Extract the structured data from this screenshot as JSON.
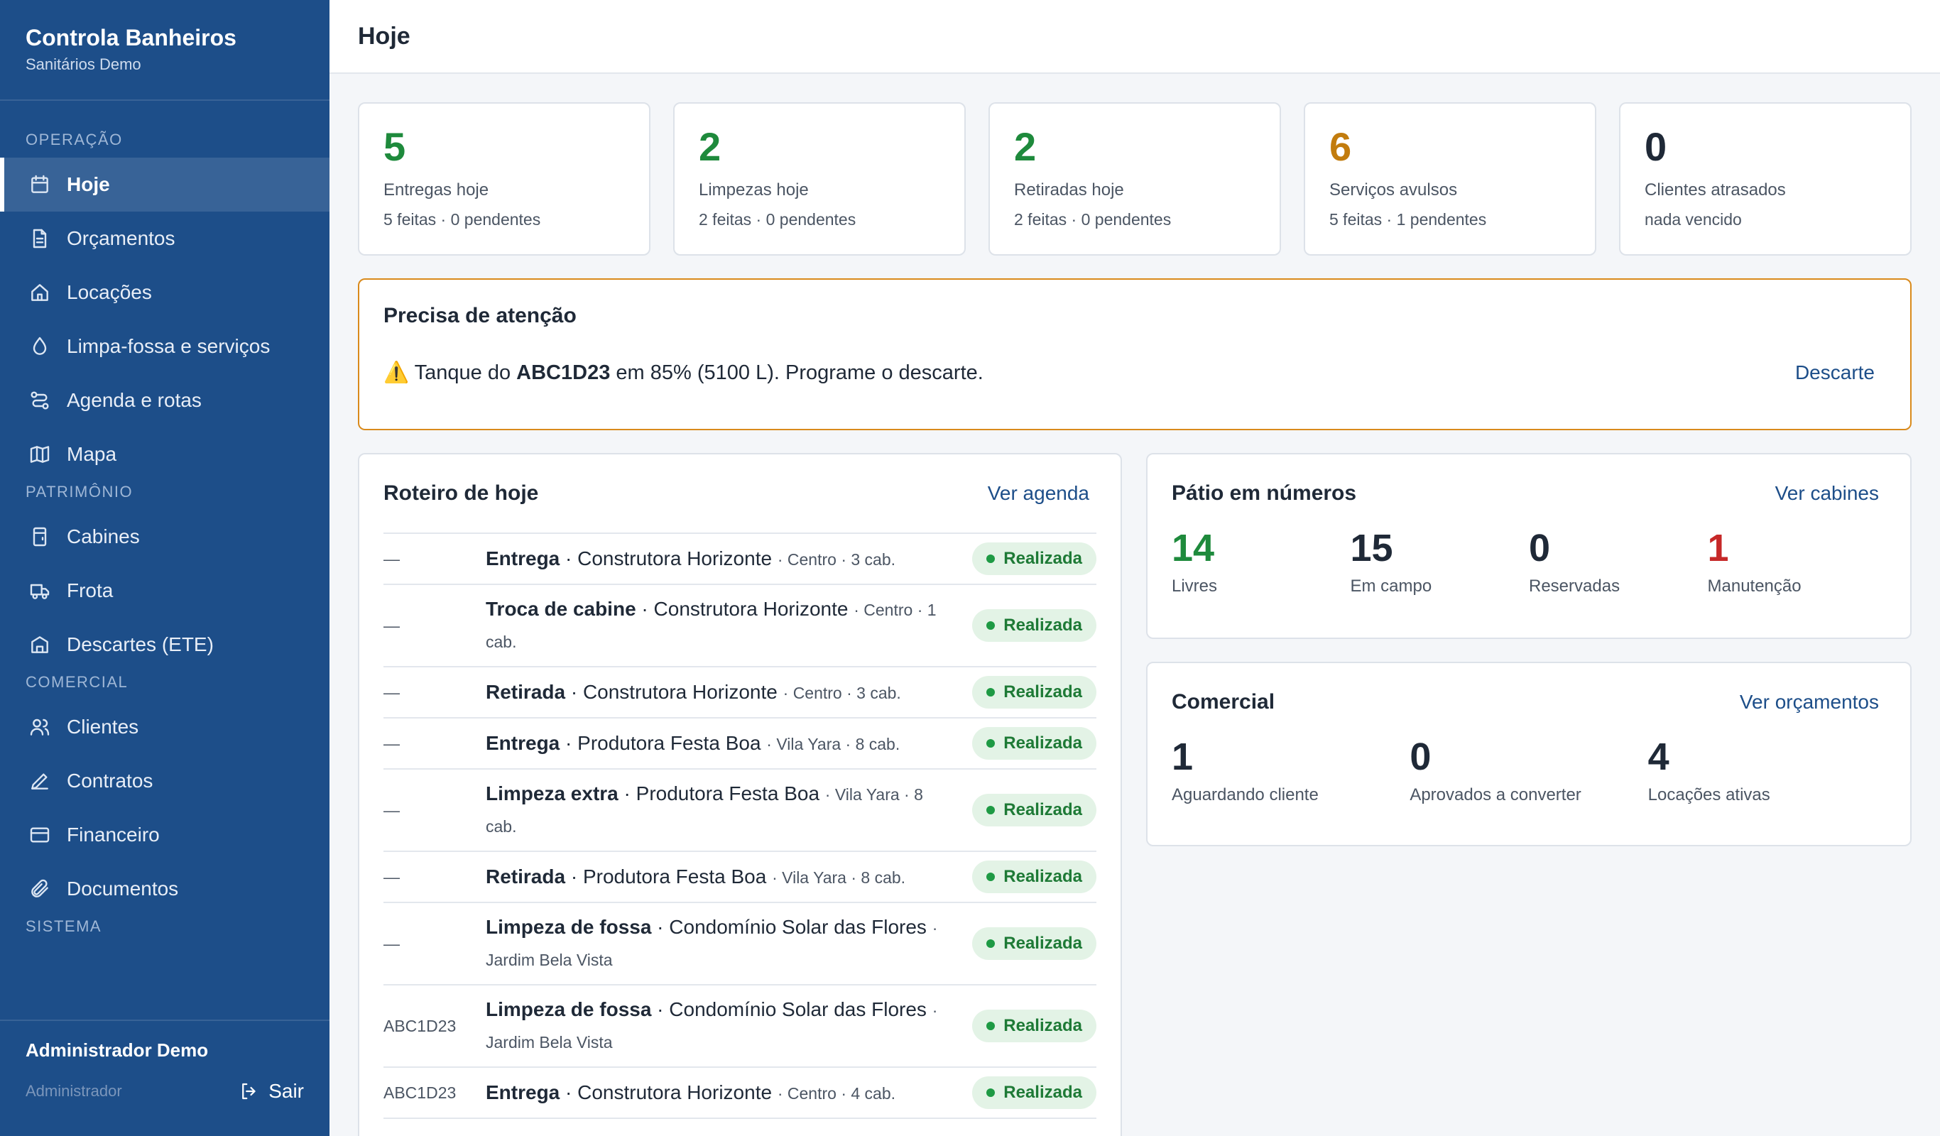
{
  "sidebar": {
    "title": "Controla Banheiros",
    "subtitle": "Sanitários Demo",
    "sections": [
      {
        "label": "OPERAÇÃO",
        "items": [
          {
            "label": "Hoje",
            "icon": "calendar-icon",
            "active": true
          },
          {
            "label": "Orçamentos",
            "icon": "document-icon"
          },
          {
            "label": "Locações",
            "icon": "home-icon"
          },
          {
            "label": "Limpa-fossa e serviços",
            "icon": "droplet-icon"
          },
          {
            "label": "Agenda e rotas",
            "icon": "route-icon"
          },
          {
            "label": "Mapa",
            "icon": "map-icon"
          }
        ]
      },
      {
        "label": "PATRIMÔNIO",
        "items": [
          {
            "label": "Cabines",
            "icon": "cabin-icon"
          },
          {
            "label": "Frota",
            "icon": "truck-icon"
          },
          {
            "label": "Descartes (ETE)",
            "icon": "building-icon"
          }
        ]
      },
      {
        "label": "COMERCIAL",
        "items": [
          {
            "label": "Clientes",
            "icon": "users-icon"
          },
          {
            "label": "Contratos",
            "icon": "pen-icon"
          },
          {
            "label": "Financeiro",
            "icon": "credit-card-icon"
          },
          {
            "label": "Documentos",
            "icon": "paperclip-icon"
          }
        ]
      },
      {
        "label": "SISTEMA",
        "items": []
      }
    ],
    "user": {
      "name": "Administrador Demo",
      "role": "Administrador",
      "logout_label": "Sair"
    }
  },
  "header": {
    "title": "Hoje"
  },
  "stats": [
    {
      "value": "5",
      "label": "Entregas hoje",
      "sub": "5 feitas · 0 pendentes",
      "color": "#1e8a3c"
    },
    {
      "value": "2",
      "label": "Limpezas hoje",
      "sub": "2 feitas · 0 pendentes",
      "color": "#1e8a3c"
    },
    {
      "value": "2",
      "label": "Retiradas hoje",
      "sub": "2 feitas · 0 pendentes",
      "color": "#1e8a3c"
    },
    {
      "value": "6",
      "label": "Serviços avulsos",
      "sub": "5 feitas · 1 pendentes",
      "color": "#c27c0e"
    },
    {
      "value": "0",
      "label": "Clientes atrasados",
      "sub": "nada vencido",
      "color": "#1f2937"
    }
  ],
  "attention": {
    "title": "Precisa de atenção",
    "icon": "⚠️",
    "text_before": "Tanque do ",
    "plate": "ABC1D23",
    "text_after": " em 85% (5100 L). Programe o descarte.",
    "action": "Descarte"
  },
  "route": {
    "title": "Roteiro de hoje",
    "link": "Ver agenda",
    "rows": [
      {
        "plate": "—",
        "service": "Entrega",
        "client": "Construtora Horizonte",
        "meta": "Centro · 3 cab.",
        "status": "Realizada"
      },
      {
        "plate": "—",
        "service": "Troca de cabine",
        "client": "Construtora Horizonte",
        "meta": "Centro · 1 cab.",
        "status": "Realizada"
      },
      {
        "plate": "—",
        "service": "Retirada",
        "client": "Construtora Horizonte",
        "meta": "Centro · 3 cab.",
        "status": "Realizada"
      },
      {
        "plate": "—",
        "service": "Entrega",
        "client": "Produtora Festa Boa",
        "meta": "Vila Yara · 8 cab.",
        "status": "Realizada"
      },
      {
        "plate": "—",
        "service": "Limpeza extra",
        "client": "Produtora Festa Boa",
        "meta": "Vila Yara · 8 cab.",
        "status": "Realizada"
      },
      {
        "plate": "—",
        "service": "Retirada",
        "client": "Produtora Festa Boa",
        "meta": "Vila Yara · 8 cab.",
        "status": "Realizada"
      },
      {
        "plate": "—",
        "service": "Limpeza de fossa",
        "client": "Condomínio Solar das Flores",
        "meta": "Jardim Bela Vista",
        "status": "Realizada"
      },
      {
        "plate": "ABC1D23",
        "service": "Limpeza de fossa",
        "client": "Condomínio Solar das Flores",
        "meta": "Jardim Bela Vista",
        "status": "Realizada"
      },
      {
        "plate": "ABC1D23",
        "service": "Entrega",
        "client": "Construtora Horizonte",
        "meta": "Centro · 4 cab.",
        "status": "Realizada"
      }
    ]
  },
  "patio": {
    "title": "Pátio em números",
    "link": "Ver cabines",
    "metrics": [
      {
        "value": "14",
        "label": "Livres",
        "color": "#1e8a3c"
      },
      {
        "value": "15",
        "label": "Em campo",
        "color": "#1f2937"
      },
      {
        "value": "0",
        "label": "Reservadas",
        "color": "#1f2937"
      },
      {
        "value": "1",
        "label": "Manutenção",
        "color": "#c62828"
      }
    ]
  },
  "comercial": {
    "title": "Comercial",
    "link": "Ver orçamentos",
    "metrics": [
      {
        "value": "1",
        "label": "Aguardando cliente"
      },
      {
        "value": "0",
        "label": "Aprovados a converter"
      },
      {
        "value": "4",
        "label": "Locações ativas"
      }
    ]
  }
}
